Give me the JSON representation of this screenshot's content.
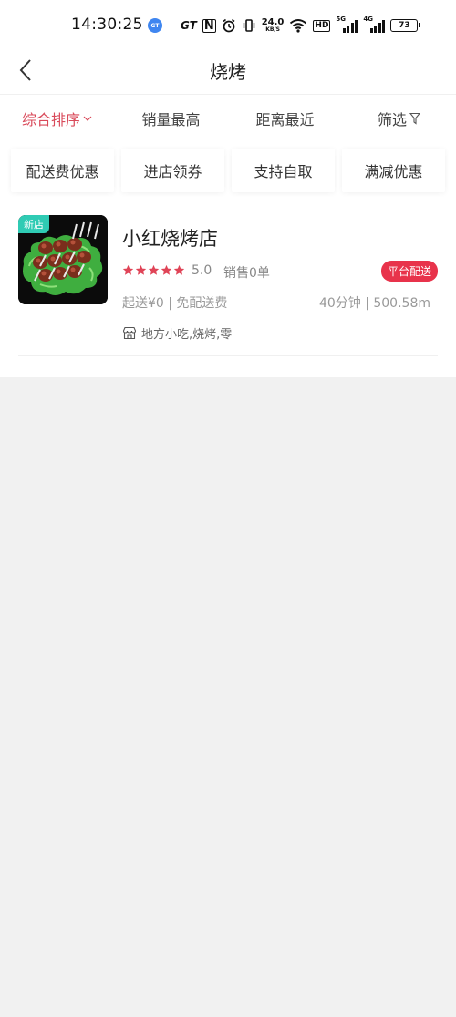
{
  "status_bar": {
    "time": "14:30:25",
    "gt_badge": "GT",
    "gt_text": "GT",
    "nfc_label": "N",
    "speed_value": "24.0",
    "speed_unit": "KB/S",
    "hd_label": "HD",
    "net1_label": "5G",
    "net2_label": "4G",
    "battery": "73"
  },
  "nav": {
    "title": "烧烤"
  },
  "sort_tabs": [
    {
      "label": "综合排序",
      "active": true
    },
    {
      "label": "销量最高"
    },
    {
      "label": "距离最近"
    },
    {
      "label": "筛选"
    }
  ],
  "chips": [
    "配送费优惠",
    "进店领券",
    "支持自取",
    "满减优惠"
  ],
  "shop": {
    "tag": "新店",
    "name": "小红烧烤店",
    "stars": 5,
    "rating": "5.0",
    "sales": "销售0单",
    "badge": "平台配送",
    "delivery": "起送¥0 | 免配送费",
    "distance": "40分钟 | 500.58m",
    "category": "地方小吃,烧烤,零"
  },
  "colors": {
    "accent": "#d94a5a",
    "badge": "#e8334b",
    "new_tag": "#2fcbb4",
    "star": "#e04457"
  }
}
